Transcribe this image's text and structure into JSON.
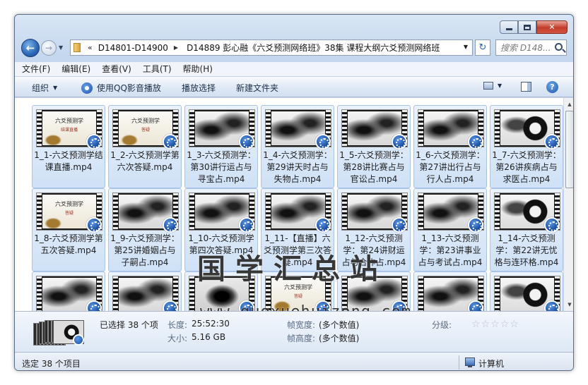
{
  "address": {
    "crumbs": [
      "D14801-D14900",
      "D14889 彭心融《六爻预测网络班》38集 课程大纲六爻预测网络班"
    ],
    "overflow": "«"
  },
  "search": {
    "placeholder": "搜索 D148..."
  },
  "menu": [
    "文件(F)",
    "编辑(E)",
    "查看(V)",
    "工具(T)",
    "帮助(H)"
  ],
  "toolbar": {
    "organize": "组织",
    "play_qq": "使用QQ影音播放",
    "play_select": "播放选择",
    "new_folder": "新建文件夹"
  },
  "thumb_text": {
    "title": "六爻预测学",
    "sub_final": "结课直播",
    "sub_qa": "答疑"
  },
  "files": [
    {
      "label": "1_1-六爻预测学结课直播.mp4",
      "thumb": "title-final"
    },
    {
      "label": "1_2-六爻预测学第六次答疑.mp4",
      "thumb": "title-qa"
    },
    {
      "label": "1_3-六爻预测学：第30讲行运占与寻宝占.mp4",
      "thumb": "ink"
    },
    {
      "label": "1_4-六爻预测学：第29讲天时占与失物占.mp4",
      "thumb": "ink"
    },
    {
      "label": "1_5-六爻预测学：第28讲比赛占与官讼占.mp4",
      "thumb": "ink"
    },
    {
      "label": "1_6-六爻预测学：第27讲出行占与行人占.mp4",
      "thumb": "ink"
    },
    {
      "label": "1_7-六爻预测学：第26讲疾病占与求医占.mp4",
      "thumb": "swirl"
    },
    {
      "label": "1_8-六爻预测学第五次答疑.mp4",
      "thumb": "title-qa"
    },
    {
      "label": "1_9-六爻预测学：第25讲婚姻占与子嗣占.mp4",
      "thumb": "ink"
    },
    {
      "label": "1_10-六爻预测学第四次答疑.mp4",
      "thumb": "ink"
    },
    {
      "label": "1_11-【直播】六爻预测学第三次答疑.mp4",
      "thumb": "ink"
    },
    {
      "label": "1_12-六爻预测学：第24讲财运占与合作占.mp4",
      "thumb": "ink"
    },
    {
      "label": "1_13-六爻预测学：第23讲事业占与考试占.mp4",
      "thumb": "ink"
    },
    {
      "label": "1_14-六爻预测学：第22讲无忧格与连环格.mp4",
      "thumb": "swirl"
    },
    {
      "label": "",
      "thumb": "ink"
    },
    {
      "label": "",
      "thumb": "ink"
    },
    {
      "label": "",
      "thumb": "dark"
    },
    {
      "label": "",
      "thumb": "title-qa"
    },
    {
      "label": "",
      "thumb": "ink"
    },
    {
      "label": "",
      "thumb": "ink"
    },
    {
      "label": "",
      "thumb": "swirl"
    }
  ],
  "watermark": {
    "cn": "国学汇总站",
    "url": "www.guoxuehuizong.com"
  },
  "details": {
    "selected": "已选择 38 个项",
    "length_key": "长度:",
    "length_val": "25:52:30",
    "size_key": "大小:",
    "size_val": "5.16 GB",
    "width_key": "帧宽度:",
    "width_val": "(多个数值)",
    "height_key": "帧高度:",
    "height_val": "(多个数值)",
    "rating_key": "分级:",
    "rating_stars": 0
  },
  "status": {
    "text": "选定 38 个项目",
    "location": "计算机"
  }
}
